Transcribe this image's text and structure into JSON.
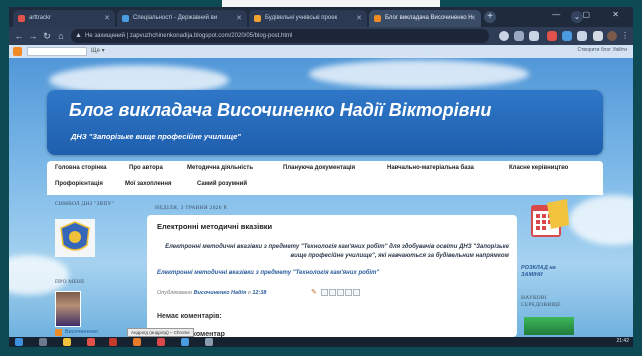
{
  "browser": {
    "tabs": [
      {
        "label": "arttrackr",
        "color": "#e0524a"
      },
      {
        "label": "Спеціальності - Державний ви",
        "color": "#4a9be0"
      },
      {
        "label": "Будівельні учнівські проек",
        "color": "#f0a232"
      },
      {
        "label": "Блог викладача Височиненко Н",
        "color": "#f08a24"
      }
    ],
    "url": "zapvuzhchinenkonadija.blogspot.com/2020/05/blog-post.html",
    "insecure_label": "Не захищений",
    "new_tab": "+",
    "window_controls": "— ▢ ✕"
  },
  "blogger_bar": {
    "more_label": "Ще ▾",
    "right_text": "Створити блог   Увійти"
  },
  "header": {
    "title": "Блог викладача Височиненко Надії Вікторівни",
    "description": "ДНЗ \"Запорізьке вище професійне училище\""
  },
  "menu": {
    "row1": [
      "Головна сторінка",
      "Про автора",
      "Методична діяльність",
      "Плануюча документація",
      "Навчально-матеріальна база",
      "Класне керівництво"
    ],
    "row2": [
      "Профорієнтація",
      "Мої захоплення",
      "Самий розумний"
    ]
  },
  "sidebar_left": {
    "emblem_heading": "СИМВОЛ ДНЗ \"ЗВПУ\"",
    "about_heading": "ПРО МЕНЕ",
    "profile_link": "Височиненко"
  },
  "post": {
    "date": "НЕДІЛЯ, 3 ТРАВНЯ 2020 Р.",
    "title": "Електронні методичні вказівки",
    "body": "Електронні методичні вказівки з предмету \"Технологія кам'яних робіт\" для здобувачів освіти ДНЗ \"Запорізьке вище професійне училище\", які навчаються за будівельним напрямком",
    "link": "Електронні методичні вказівки з предмету \"Технологія кам'яних робіт\"",
    "meta_prefix": "Опубліковано",
    "author": "Височиненко Надія",
    "time": "12:38",
    "no_comments": "Немає коментарів:",
    "add_comment": "Дописати коментар"
  },
  "sidebar_right": {
    "schedule_label": "РОЗКЛАД на ЗАМІНИ",
    "heading": "НАУКОВІ СЕРЕДОВИЩЕ"
  },
  "taskbar": {
    "tooltip": "Андроїд (андроїд) – Chrome",
    "clock": "21:42"
  }
}
